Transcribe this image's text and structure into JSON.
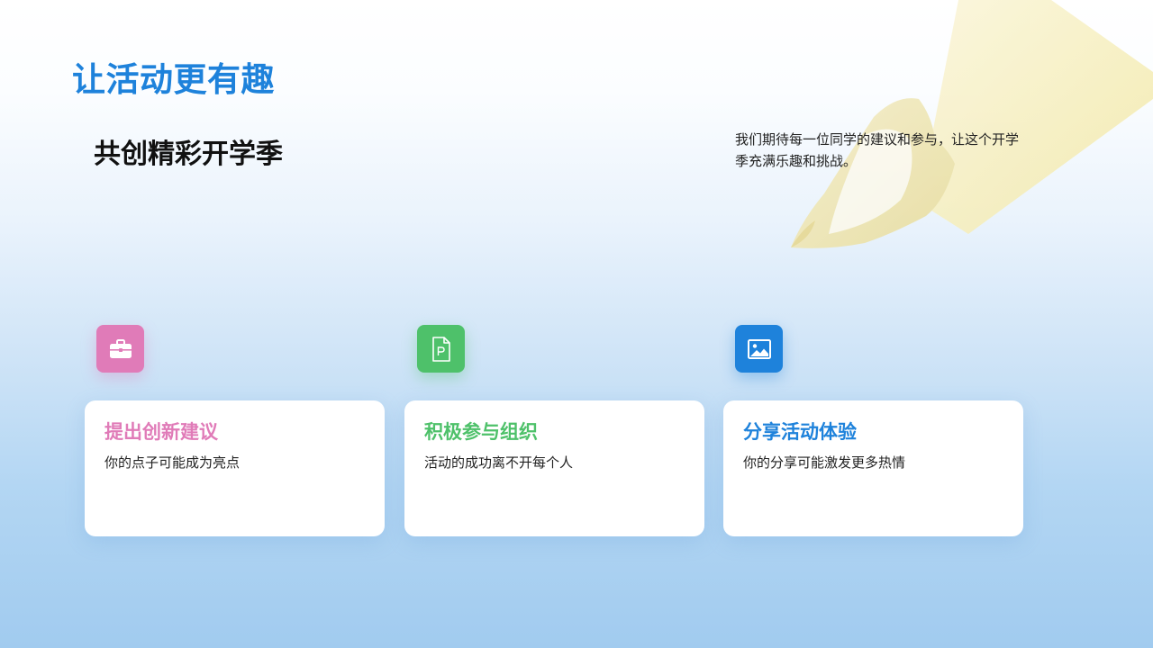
{
  "page": {
    "title": "让活动更有趣",
    "subtitle": "共创精彩开学季",
    "intro": "我们期待每一位同学的建议和参与，让这个开学季充满乐趣和挑战。"
  },
  "colors": {
    "title": "#1e82db",
    "pink": "#e07bb8",
    "green": "#4ec16a",
    "blue": "#1e82db"
  },
  "cards": [
    {
      "icon": "briefcase-icon",
      "title": "提出创新建议",
      "desc": "你的点子可能成为亮点",
      "color": "#e07bb8"
    },
    {
      "icon": "document-icon",
      "title": "积极参与组织",
      "desc": "活动的成功离不开每个人",
      "color": "#4ec16a"
    },
    {
      "icon": "image-icon",
      "title": "分享活动体验",
      "desc": "你的分享可能激发更多热情",
      "color": "#1e82db"
    }
  ]
}
